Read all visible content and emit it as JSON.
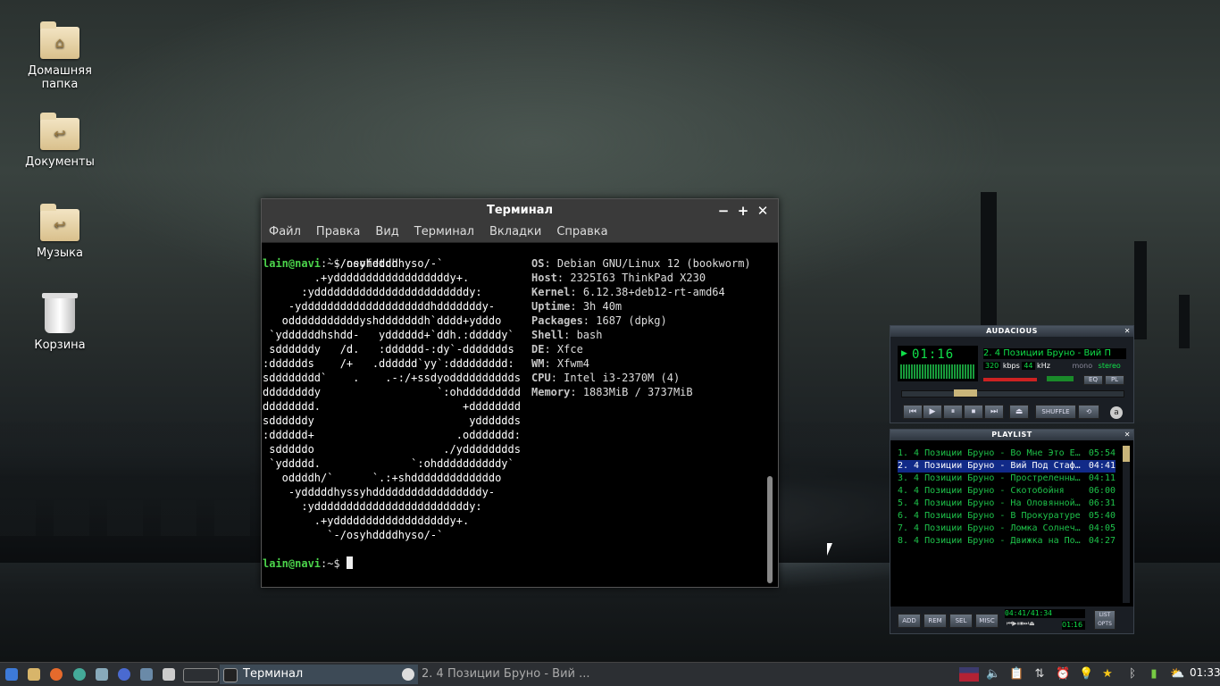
{
  "desktop": {
    "icons": [
      {
        "label": "Домашняя\nпапка",
        "icon": "home-folder-icon"
      },
      {
        "label": "Документы",
        "icon": "documents-folder-icon"
      },
      {
        "label": "Музыка",
        "icon": "music-folder-icon"
      },
      {
        "label": "Корзина",
        "icon": "trash-icon"
      }
    ]
  },
  "terminal": {
    "title": "Терминал",
    "menu": [
      "Файл",
      "Правка",
      "Вид",
      "Терминал",
      "Вкладки",
      "Справка"
    ],
    "prompt_user": "lain@navi",
    "prompt_suffix": ":~$ ",
    "command": "neofetch",
    "ascii": [
      "          `-/osyhddddhyso/-`",
      "        .+yddddddddddddddddddy+.",
      "      :yddddddddddddddddddddddddy:",
      "    -yddddddddddddddddddddhdddddddy-",
      "   odddddddddddyshdddddddh`dddd+ydddo",
      " `yddddddhshdd-   ydddddd+`ddh.:dddddy`",
      " sddddddy   /d.   :dddddd-:dy`-ddddddds",
      ":dddddds    /+   .dddddd`yy`:ddddddddd:",
      "sdddddddd`    .    .-:/+ssdyodddddddddds",
      "ddddddddy                  `:ohddddddddd",
      "dddddddd.                      +dddddddd",
      "sddddddy                        ydddddds",
      ":dddddd+                      .oddddddd:",
      " sdddddo                    ./ydddddddds",
      " `yddddd.              `:ohddddddddddy`",
      "   oddddh/`      `.:+shdddddddddddddo",
      "    -ydddddhyssyhdddddddddddddddddy-",
      "      :yddddddddddddddddddddddddy:",
      "        .+yddddddddddddddddddy+.",
      "          `-/osyhddddhyso/-`"
    ],
    "info": [
      {
        "key": "OS",
        "value": "Debian GNU/Linux 12 (bookworm)"
      },
      {
        "key": "Host",
        "value": "2325I63 ThinkPad X230"
      },
      {
        "key": "Kernel",
        "value": "6.12.38+deb12-rt-amd64"
      },
      {
        "key": "Uptime",
        "value": "3h 40m"
      },
      {
        "key": "Packages",
        "value": "1687 (dpkg)"
      },
      {
        "key": "Shell",
        "value": "bash"
      },
      {
        "key": "DE",
        "value": "Xfce"
      },
      {
        "key": "WM",
        "value": "Xfwm4"
      },
      {
        "key": "CPU",
        "value": "Intel i3-2370M (4)"
      },
      {
        "key": "Memory",
        "value": "1883MiB / 3737MiB"
      }
    ]
  },
  "audacious": {
    "title": "AUDACIOUS",
    "time": "01:16",
    "song": "2. 4 Позиции Бруно - Вий П",
    "kbps": "320",
    "khz": "44",
    "mono": "mono",
    "stereo": "stereo",
    "shuffle": "SHUFFLE",
    "eq": "EQ",
    "pl": "PL",
    "playlist_title": "PLAYLIST",
    "playlist": [
      {
        "title": "1. 4 Позиции Бруно - Во Мне Это Е…",
        "time": "05:54"
      },
      {
        "title": "2. 4 Позиции Бруно - Вий Под Стаф…",
        "time": "04:41"
      },
      {
        "title": "3. 4 Позиции Бруно - Простреленны…",
        "time": "04:11"
      },
      {
        "title": "4. 4 Позиции Бруно - Скотобойня",
        "time": "06:00"
      },
      {
        "title": "5. 4 Позиции Бруно - На Оловянной…",
        "time": "06:31"
      },
      {
        "title": "6. 4 Позиции Бруно - В Прокуратуре",
        "time": "05:40"
      },
      {
        "title": "7. 4 Позиции Бруно - Ломка Солнеч…",
        "time": "04:05"
      },
      {
        "title": "8. 4 Позиции Бруно - Движка на По…",
        "time": "04:27"
      }
    ],
    "selected_index": 1,
    "buttons": [
      "ADD",
      "REM",
      "SEL",
      "MISC"
    ],
    "total": "04:41/41:34",
    "mini_time": "01:16",
    "list_opts": "LIST OPTS"
  },
  "taskbar": {
    "tasks": [
      {
        "label": "Терминал",
        "icon": "terminal-icon",
        "active": true
      },
      {
        "label": "2. 4 Позиции Бруно - Вий ...",
        "icon": "audacious-icon",
        "active": false
      }
    ],
    "clock": "01:33"
  },
  "colors": {
    "prompt": "#4bd34b",
    "info_key": "#c6c6c6",
    "winamp_green": "#10e04a",
    "selection": "#112a88"
  }
}
